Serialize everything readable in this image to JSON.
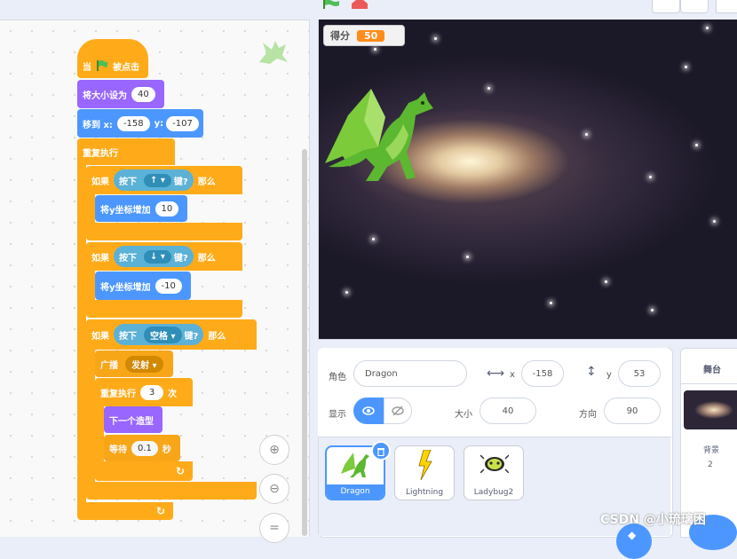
{
  "colors": {
    "events": "#ffab19",
    "looks": "#9966ff",
    "motion": "#4c97ff",
    "control": "#ffab19",
    "sensing": "#5cb1d6",
    "accent": "#4c97ff",
    "monitor": "#ff8c1a"
  },
  "scripts": {
    "when_flag": {
      "pre": "当",
      "post": "被点击"
    },
    "set_size": {
      "label": "将大小设为",
      "value": "40"
    },
    "goto": {
      "label": "移到 x:",
      "x": "-158",
      "ylabel": "y:",
      "y": "-107"
    },
    "forever": {
      "label": "重复执行"
    },
    "if1": {
      "if": "如果",
      "press": "按下",
      "key": "↑",
      "key_suffix": "键?",
      "then": "那么",
      "action": "将y坐标增加",
      "value": "10"
    },
    "if2": {
      "if": "如果",
      "press": "按下",
      "key": "↓",
      "key_suffix": "键?",
      "then": "那么",
      "action": "将y坐标增加",
      "value": "-10"
    },
    "if3": {
      "if": "如果",
      "press": "按下",
      "key": "空格",
      "key_suffix": "键?",
      "then": "那么",
      "broadcast": "广播",
      "message": "发射",
      "repeat": "重复执行",
      "repeat_count": "3",
      "repeat_unit": "次",
      "next_costume": "下一个造型",
      "wait": "等待",
      "wait_value": "0.1",
      "wait_unit": "秒"
    }
  },
  "stage": {
    "monitor_label": "得分",
    "monitor_value": "50"
  },
  "sprite_info": {
    "sprite_label": "角色",
    "sprite_name": "Dragon",
    "x_label": "x",
    "x_value": "-158",
    "y_label": "y",
    "y_value": "53",
    "show_label": "显示",
    "size_label": "大小",
    "size_value": "40",
    "direction_label": "方向",
    "direction_value": "90"
  },
  "sprites": [
    {
      "name": "Dragon",
      "selected": true
    },
    {
      "name": "Lightning",
      "selected": false
    },
    {
      "name": "Ladybug2",
      "selected": false
    }
  ],
  "stage_panel": {
    "title": "舞台",
    "backdrop_label": "背景",
    "backdrop_count": "2"
  },
  "watermark": "CSDN @小琉璃困"
}
